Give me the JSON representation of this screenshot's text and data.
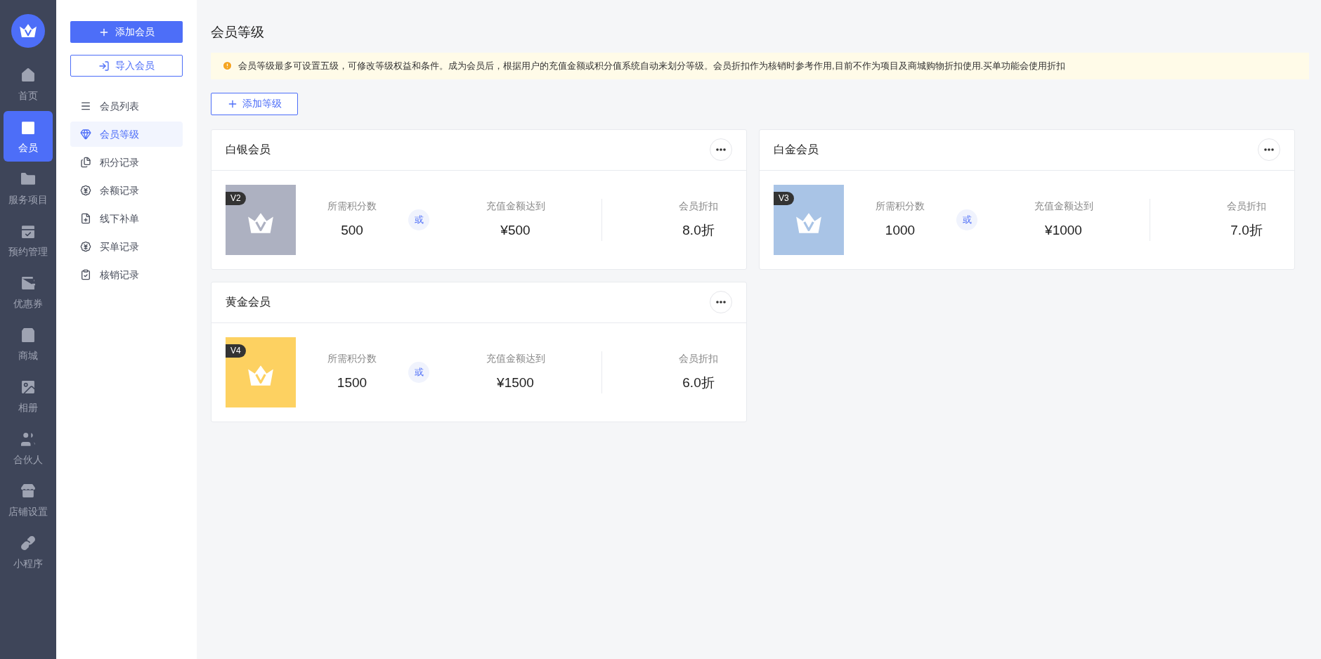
{
  "nav": {
    "items": [
      {
        "label": "首页",
        "selected": false
      },
      {
        "label": "会员",
        "selected": true
      },
      {
        "label": "服务项目",
        "selected": false
      },
      {
        "label": "预约管理",
        "selected": false
      },
      {
        "label": "优惠券",
        "selected": false
      },
      {
        "label": "商城",
        "selected": false
      },
      {
        "label": "相册",
        "selected": false
      },
      {
        "label": "合伙人",
        "selected": false
      },
      {
        "label": "店铺设置",
        "selected": false
      },
      {
        "label": "小程序",
        "selected": false
      }
    ]
  },
  "sidebar": {
    "primary_button": "添加会员",
    "secondary_button": "导入会员",
    "items": [
      {
        "label": "会员列表",
        "selected": false
      },
      {
        "label": "会员等级",
        "selected": true
      },
      {
        "label": "积分记录",
        "selected": false
      },
      {
        "label": "余额记录",
        "selected": false
      },
      {
        "label": "线下补单",
        "selected": false
      },
      {
        "label": "买单记录",
        "selected": false
      },
      {
        "label": "核销记录",
        "selected": false
      }
    ]
  },
  "page": {
    "title": "会员等级",
    "notice": "会员等级最多可设置五级，可修改等级权益和条件。成为会员后，根据用户的充值金额或积分值系统自动来划分等级。会员折扣作为核销时参考作用,目前不作为项目及商城购物折扣使用.买单功能会使用折扣",
    "add_button": "添加等级"
  },
  "levels": [
    {
      "name": "白银会员",
      "badge": "V2",
      "color": "#adb1c1",
      "points_label": "所需积分数",
      "points": "500",
      "or": "或",
      "recharge_label": "充值金额达到",
      "recharge": "¥500",
      "discount_label": "会员折扣",
      "discount": "8.0折"
    },
    {
      "name": "白金会员",
      "badge": "V3",
      "color": "#a9c4e6",
      "points_label": "所需积分数",
      "points": "1000",
      "or": "或",
      "recharge_label": "充值金额达到",
      "recharge": "¥1000",
      "discount_label": "会员折扣",
      "discount": "7.0折"
    },
    {
      "name": "黄金会员",
      "badge": "V4",
      "color": "#fdd161",
      "points_label": "所需积分数",
      "points": "1500",
      "or": "或",
      "recharge_label": "充值金额达到",
      "recharge": "¥1500",
      "discount_label": "会员折扣",
      "discount": "6.0折"
    }
  ]
}
